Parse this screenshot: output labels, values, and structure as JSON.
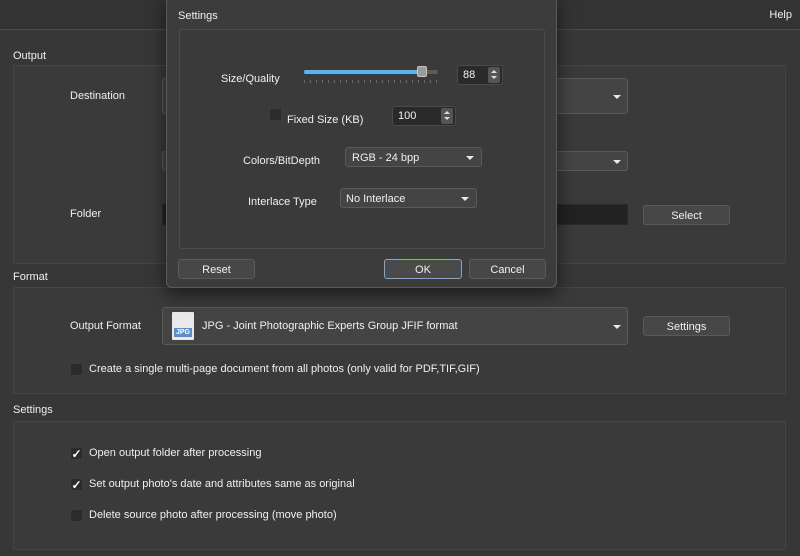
{
  "menu": {
    "help": "Help"
  },
  "output": {
    "section_title": "Output",
    "destination_label": "Destination",
    "folder_label": "Folder",
    "select_button": "Select"
  },
  "format": {
    "section_title": "Format",
    "output_format_label": "Output Format",
    "output_format_value": "JPG - Joint Photographic Experts Group JFIF format",
    "file_badge": "JPG",
    "settings_button": "Settings",
    "multipage_label": "Create a single multi-page document from all photos (only valid for PDF,TIF,GIF)"
  },
  "settings": {
    "section_title": "Settings",
    "open_folder": {
      "label": "Open output folder after processing",
      "checked": true
    },
    "same_date": {
      "label": "Set output photo's date and attributes same as original",
      "checked": true
    },
    "delete_source": {
      "label": "Delete source photo after processing (move photo)",
      "checked": false
    }
  },
  "dialog": {
    "title": "Settings",
    "size_quality_label": "Size/Quality",
    "size_quality_value": "88",
    "slider_fraction": 0.88,
    "fixed_size_label": "Fixed Size (KB)",
    "fixed_size_checked": false,
    "fixed_size_value": "100",
    "colors_label": "Colors/BitDepth",
    "colors_value": "RGB - 24 bpp",
    "interlace_label": "Interlace Type",
    "interlace_value": "No Interlace",
    "reset_button": "Reset",
    "ok_button": "OK",
    "cancel_button": "Cancel"
  },
  "colors": {
    "accent": "#5ab4f0",
    "background": "#373737"
  },
  "check_mark": "✓"
}
